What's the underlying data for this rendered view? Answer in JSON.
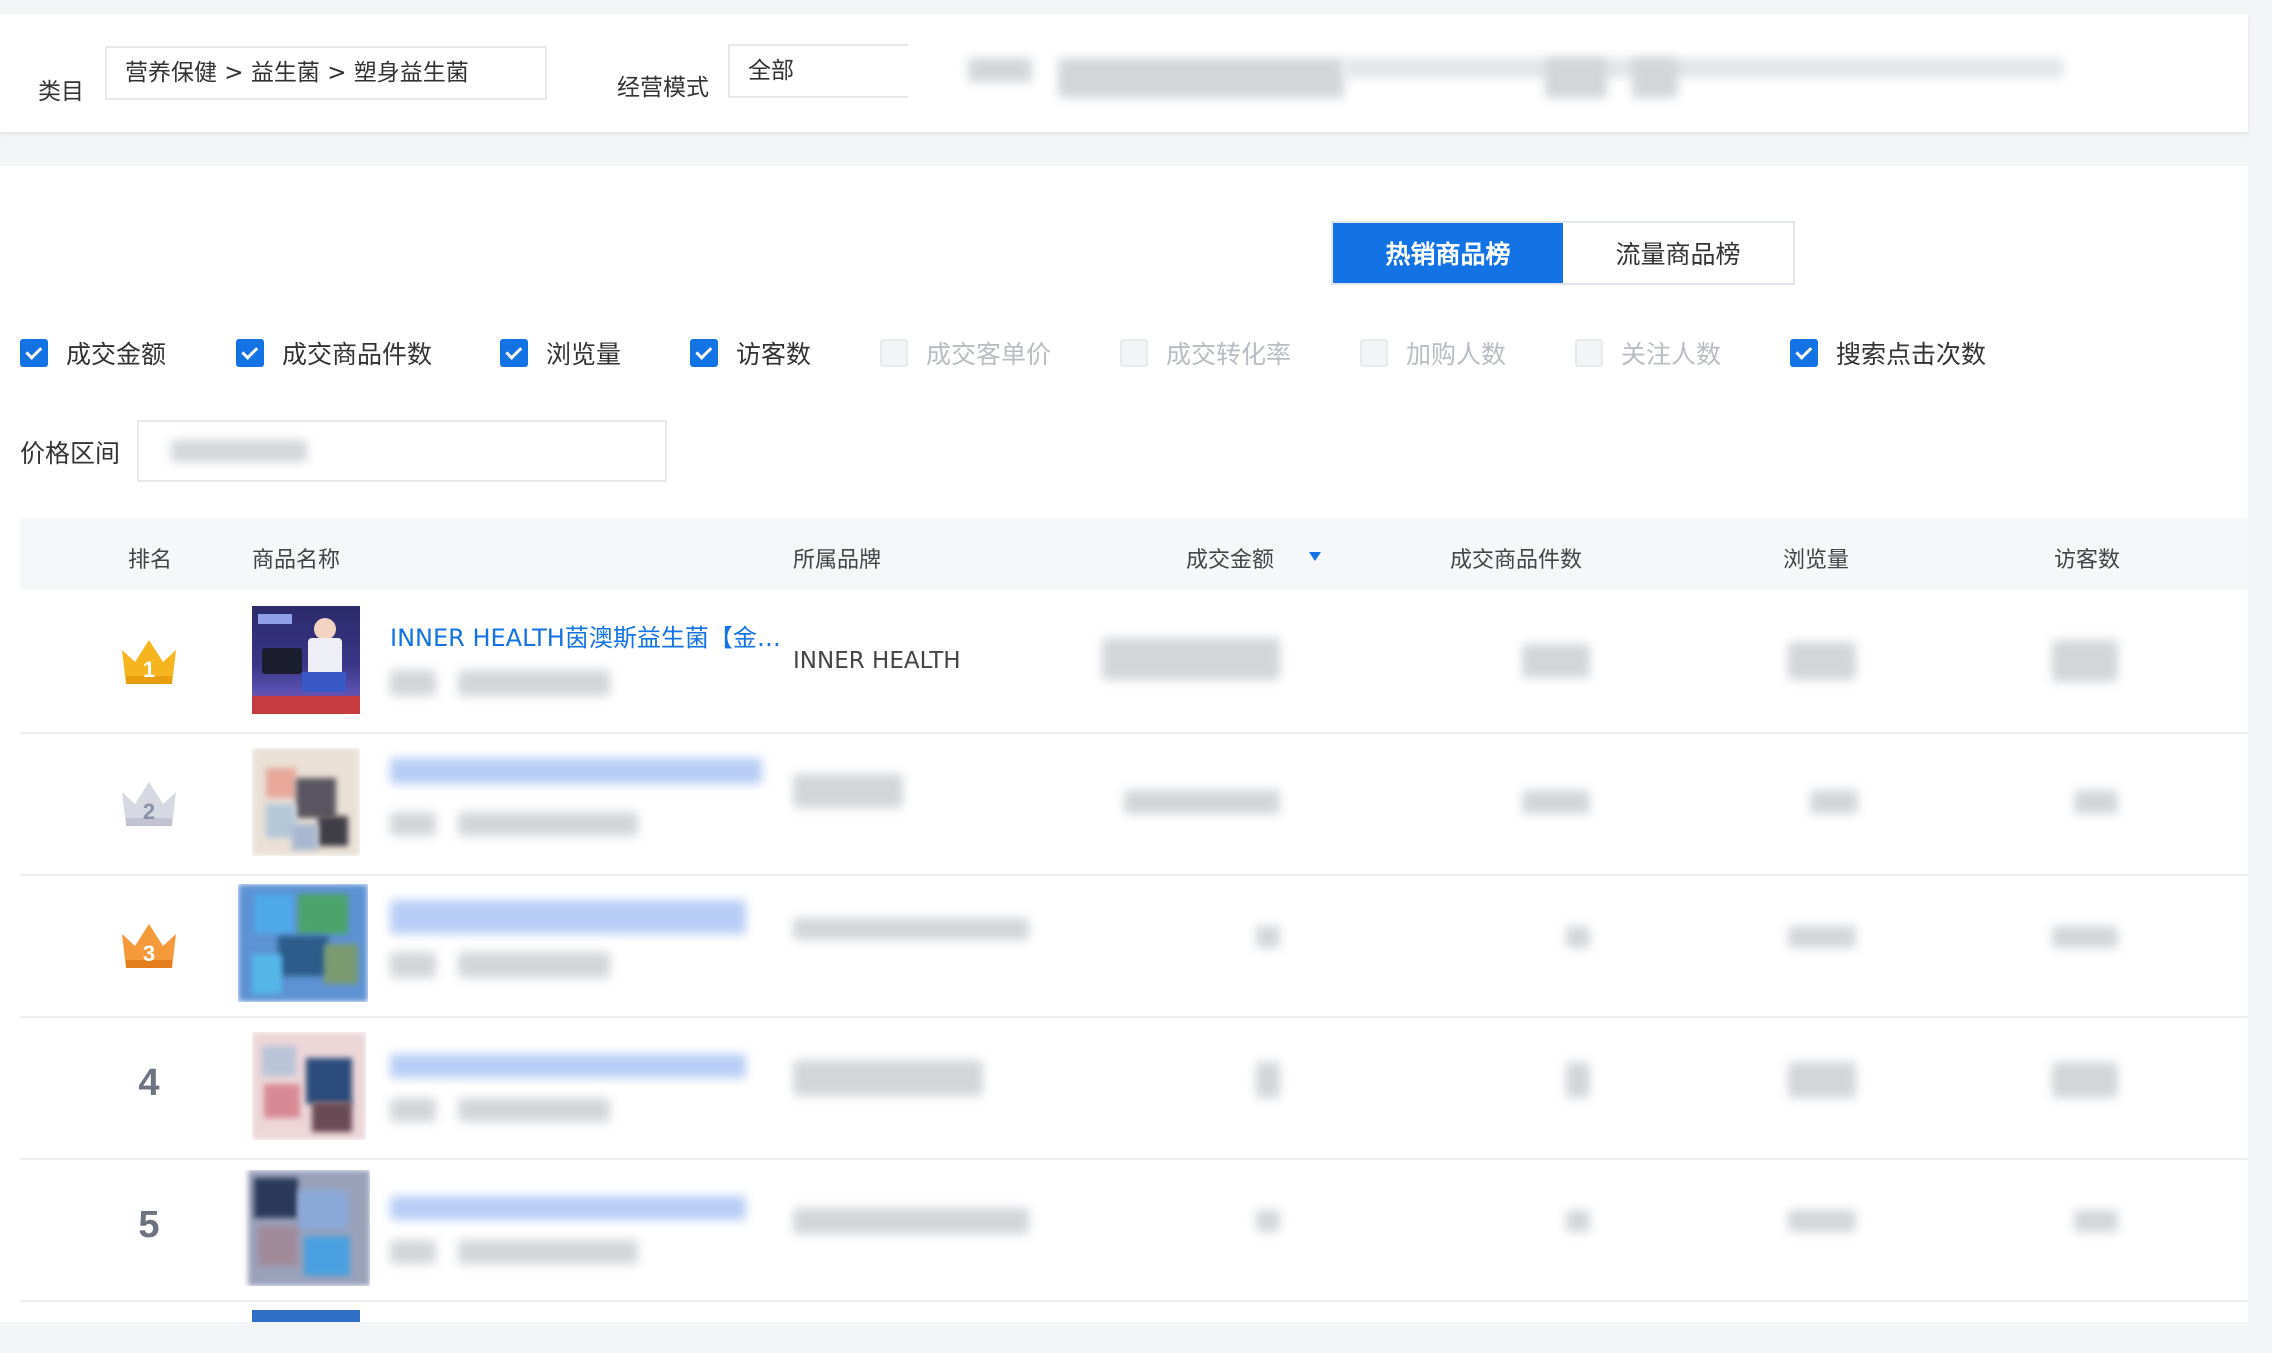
{
  "filters": {
    "category_label": "类目",
    "category_value": "营养保健 > 益生菌 > 塑身益生菌",
    "mode_label": "经营模式",
    "mode_value": "全部"
  },
  "rank_tabs": [
    "热销商品榜",
    "流量商品榜"
  ],
  "metrics": [
    {
      "label": "成交金额",
      "checked": true
    },
    {
      "label": "成交商品件数",
      "checked": true
    },
    {
      "label": "浏览量",
      "checked": true
    },
    {
      "label": "访客数",
      "checked": true
    },
    {
      "label": "成交客单价",
      "checked": false
    },
    {
      "label": "成交转化率",
      "checked": false
    },
    {
      "label": "加购人数",
      "checked": false
    },
    {
      "label": "关注人数",
      "checked": false
    },
    {
      "label": "搜索点击次数",
      "checked": true
    }
  ],
  "price_range_label": "价格区间",
  "table": {
    "columns": [
      "排名",
      "商品名称",
      "所属品牌",
      "成交金额",
      "成交商品件数",
      "浏览量",
      "访客数"
    ],
    "sort_column": "成交金额",
    "sort_direction": "desc",
    "rows": [
      {
        "rank": "1",
        "name": "INNER HEALTH茵澳斯益生菌【金…",
        "brand": "INNER HEALTH"
      },
      {
        "rank": "2",
        "name": "",
        "brand": ""
      },
      {
        "rank": "3",
        "name": "",
        "brand": ""
      },
      {
        "rank": "4",
        "name": "",
        "brand": ""
      },
      {
        "rank": "5",
        "name": "",
        "brand": ""
      }
    ]
  },
  "colors": {
    "accent": "#1373e4",
    "gold": "#f6b51e",
    "silver": "#c9ccd6",
    "bronze": "#f28a2a"
  },
  "icons": {
    "crown": "crown-icon",
    "checkbox": "checkbox-icon",
    "sort": "sort-desc-icon"
  }
}
